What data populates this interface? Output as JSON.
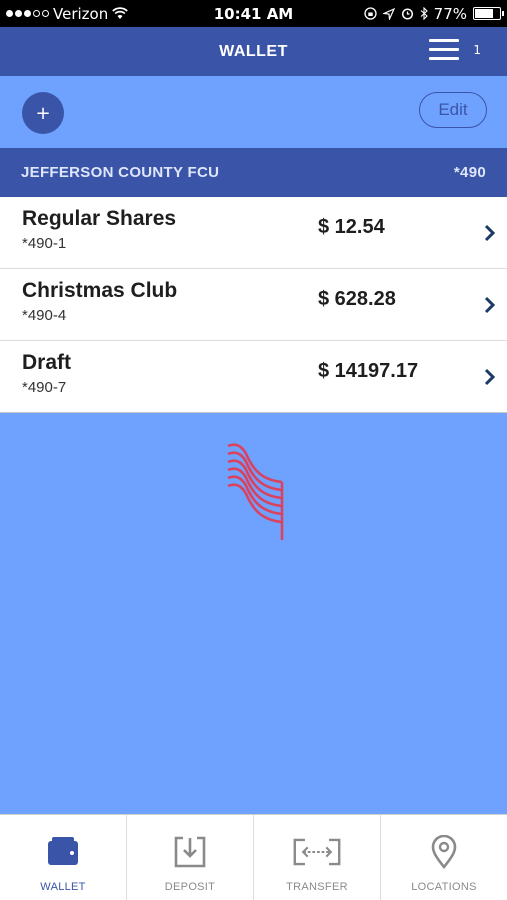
{
  "status_bar": {
    "carrier": "Verizon",
    "time": "10:41 AM",
    "battery_percent": "77%",
    "battery_level": 0.77,
    "icons": [
      "signal-dots",
      "wifi-icon",
      "lock-rotation-icon",
      "location-icon",
      "alarm-icon",
      "bluetooth-icon",
      "battery-icon"
    ]
  },
  "header": {
    "title": "WALLET",
    "menu_count": "1"
  },
  "toolbar": {
    "add_label": "+",
    "edit_label": "Edit"
  },
  "institution": {
    "name": "JEFFERSON COUNTY FCU",
    "account_suffix": "*490"
  },
  "accounts": [
    {
      "name": "Regular Shares",
      "number": "*490-1",
      "balance": "$ 12.54"
    },
    {
      "name": "Christmas Club",
      "number": "*490-4",
      "balance": "$ 628.28"
    },
    {
      "name": "Draft",
      "number": "*490-7",
      "balance": "$ 14197.17"
    }
  ],
  "tabs": [
    {
      "label": "WALLET",
      "icon": "wallet-icon",
      "active": true
    },
    {
      "label": "DEPOSIT",
      "icon": "deposit-icon",
      "active": false
    },
    {
      "label": "TRANSFER",
      "icon": "transfer-icon",
      "active": false
    },
    {
      "label": "LOCATIONS",
      "icon": "location-pin-icon",
      "active": false
    }
  ],
  "colors": {
    "brand": "#3a55a8",
    "background": "#6fa2ff",
    "spinner": "#d9435f",
    "inactive": "#8a8a8a"
  }
}
